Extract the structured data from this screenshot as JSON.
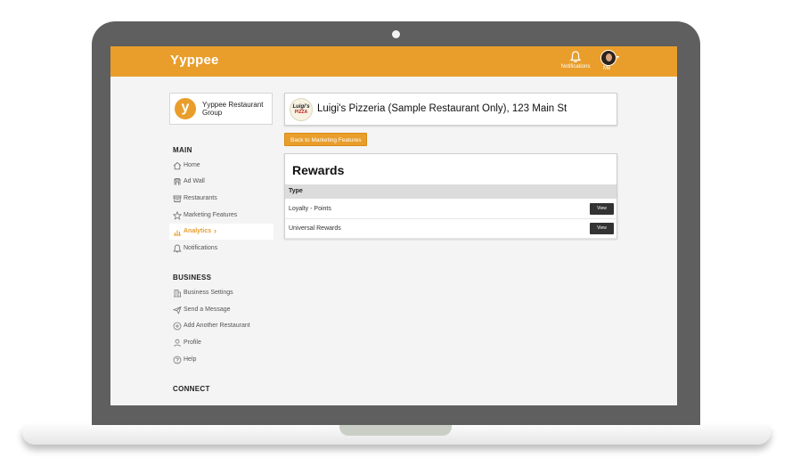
{
  "app": {
    "brand": "Yyppee"
  },
  "topbar": {
    "notifications_label": "Notifications",
    "me_label": "Me"
  },
  "sidebar": {
    "org": {
      "logo_letter": "y",
      "name": "Yyppee Restaurant Group"
    },
    "sections": [
      {
        "title": "MAIN",
        "items": [
          {
            "label": "Home",
            "icon": "home-icon"
          },
          {
            "label": "Ad Wall",
            "icon": "ad-wall-icon"
          },
          {
            "label": "Restaurants",
            "icon": "store-icon"
          },
          {
            "label": "Marketing Features",
            "icon": "star-icon"
          },
          {
            "label": "Analytics",
            "icon": "bar-chart-icon",
            "active": true
          },
          {
            "label": "Notifications",
            "icon": "bell-icon"
          }
        ]
      },
      {
        "title": "BUSINESS",
        "items": [
          {
            "label": "Business Settings",
            "icon": "building-icon"
          },
          {
            "label": "Send a Message",
            "icon": "paper-plane-icon"
          },
          {
            "label": "Add Another Restaurant",
            "icon": "plus-circle-icon"
          },
          {
            "label": "Profile",
            "icon": "user-icon"
          },
          {
            "label": "Help",
            "icon": "question-circle-icon"
          }
        ]
      },
      {
        "title": "CONNECT",
        "items": []
      }
    ]
  },
  "restaurant": {
    "logo_line1": "Luigi's",
    "logo_line2": "PIZZA",
    "name": "Luigi's Pizzeria (Sample Restaurant Only), 123 Main St"
  },
  "actions": {
    "back_label": "Back to Marketing Features"
  },
  "rewards": {
    "title": "Rewards",
    "column_type": "Type",
    "rows": [
      {
        "type": "Loyalty - Points",
        "action": "View"
      },
      {
        "type": "Universal Rewards",
        "action": "View"
      }
    ]
  },
  "colors": {
    "accent": "#e99e2b",
    "laptop_frame": "#5f5f5f",
    "screen_bg": "#f4f4f4",
    "button_dark": "#333333"
  }
}
